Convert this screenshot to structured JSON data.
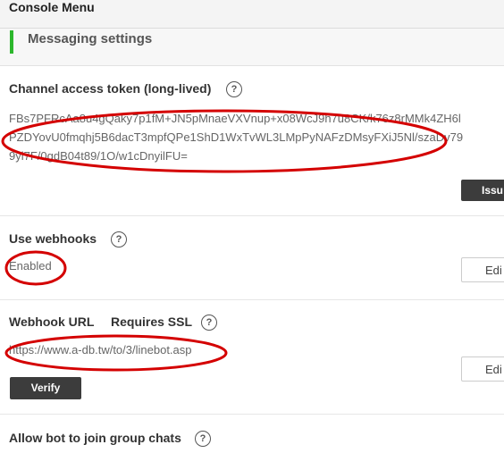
{
  "header": {
    "title": "Console Menu"
  },
  "subheader": {
    "label": "Messaging settings"
  },
  "token_section": {
    "title": "Channel access token (long-lived)",
    "lines": [
      "FBs7PFRcAa8u4gQaky7p1fM+JN5pMnaeVXVnup+x08WcJ9h7u8CK/k76z8rMMk4ZH6l",
      "PZDYovU0fmqhj5B6dacT3mpfQPe1ShD1WxTvWL3LMpPyNAFzDMsyFXiJ5Nl/szaDv79",
      "9yl7F/0gdB04t89/1O/w1cDnyilFU="
    ],
    "issue_label": "Issu"
  },
  "webhooks_section": {
    "title": "Use webhooks",
    "status": "Enabled",
    "edit_label": "Edi"
  },
  "webhook_url_section": {
    "title": "Webhook URL",
    "ssl_label": "Requires SSL",
    "url": "https://www.a-db.tw/to/3/linebot.asp",
    "verify_label": "Verify",
    "edit_label": "Edi"
  },
  "group_section": {
    "title": "Allow bot to join group chats"
  },
  "help_glyph": "?",
  "annotation_color": "#d40000"
}
